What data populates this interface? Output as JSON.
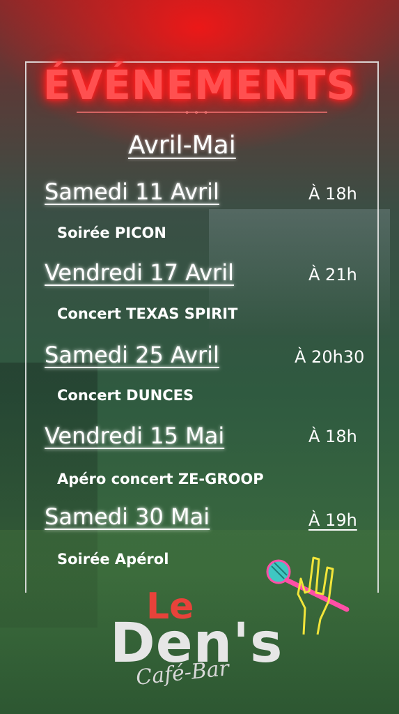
{
  "header": {
    "title": "ÉVÉNEMENTS",
    "subtitle": "Avril-Mai"
  },
  "events": [
    {
      "date": "Samedi 11 Avril",
      "time": "À 18h",
      "description": "Soirée PICON"
    },
    {
      "date": "Vendredi 17 Avril",
      "time": "À 21h",
      "description": "Concert TEXAS SPIRIT"
    },
    {
      "date": "Samedi 25 Avril",
      "time": "À 20h30",
      "description": "Concert DUNCES"
    },
    {
      "date": "Vendredi 15 Mai",
      "time": "À 18h",
      "description": "Apéro concert ZE-GROOP"
    },
    {
      "date": "Samedi 30 Mai",
      "time": "À 19h",
      "description": "Soirée Apérol"
    }
  ],
  "logo": {
    "le": "Le",
    "name": "Den's",
    "tagline": "Café-Bar"
  },
  "colors": {
    "title_neon": "#ff5050",
    "logo_red": "#e8423a"
  },
  "icons": [
    "microphone-rock-hand-icon"
  ]
}
